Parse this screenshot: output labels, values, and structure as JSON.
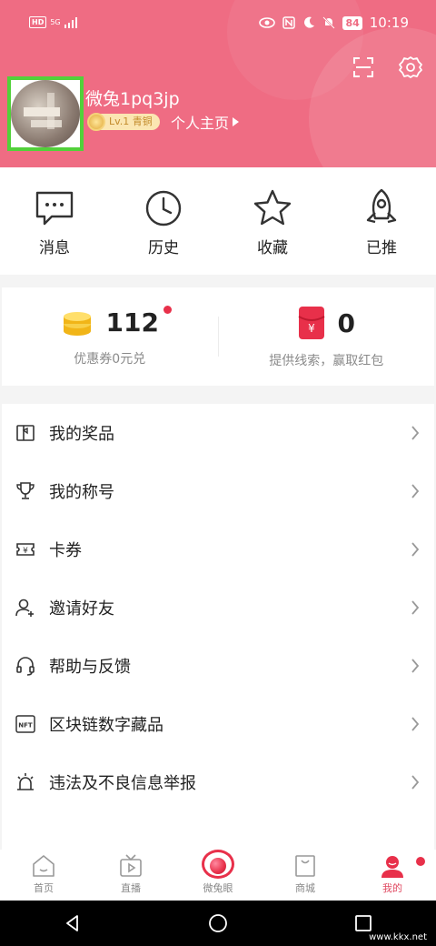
{
  "status_bar": {
    "hd": "HD",
    "network": "5G",
    "battery": "84",
    "time": "10:19"
  },
  "header": {
    "username": "微兔1pq3jp",
    "level": "Lv.1 青铜",
    "homepage_label": "个人主页"
  },
  "quick_actions": [
    {
      "label": "消息",
      "icon": "message-icon"
    },
    {
      "label": "历史",
      "icon": "clock-icon"
    },
    {
      "label": "收藏",
      "icon": "star-icon"
    },
    {
      "label": "已推",
      "icon": "rocket-icon"
    }
  ],
  "stats": {
    "coupons": {
      "value": "112",
      "sub": "优惠券0元兑"
    },
    "redpacket": {
      "value": "0",
      "sub": "提供线索，赢取红包"
    }
  },
  "menu": [
    {
      "label": "我的奖品",
      "icon": "prize-icon"
    },
    {
      "label": "我的称号",
      "icon": "trophy-icon"
    },
    {
      "label": "卡券",
      "icon": "ticket-icon"
    },
    {
      "label": "邀请好友",
      "icon": "invite-user-icon"
    },
    {
      "label": "帮助与反馈",
      "icon": "headset-icon"
    },
    {
      "label": "区块链数字藏品",
      "icon": "nft-icon"
    },
    {
      "label": "违法及不良信息举报",
      "icon": "alarm-icon"
    }
  ],
  "bottom_nav": [
    {
      "label": "首页",
      "icon": "home-icon"
    },
    {
      "label": "直播",
      "icon": "tv-icon"
    },
    {
      "label": "微兔眼",
      "icon": "eye-icon"
    },
    {
      "label": "商城",
      "icon": "shopping-bag-icon"
    },
    {
      "label": "我的",
      "icon": "profile-icon",
      "active": true
    }
  ],
  "watermark": "www.kkx.net",
  "colors": {
    "header_bg": "#ef6c83",
    "accent_red": "#e8304a",
    "avatar_highlight": "#52d13a"
  }
}
